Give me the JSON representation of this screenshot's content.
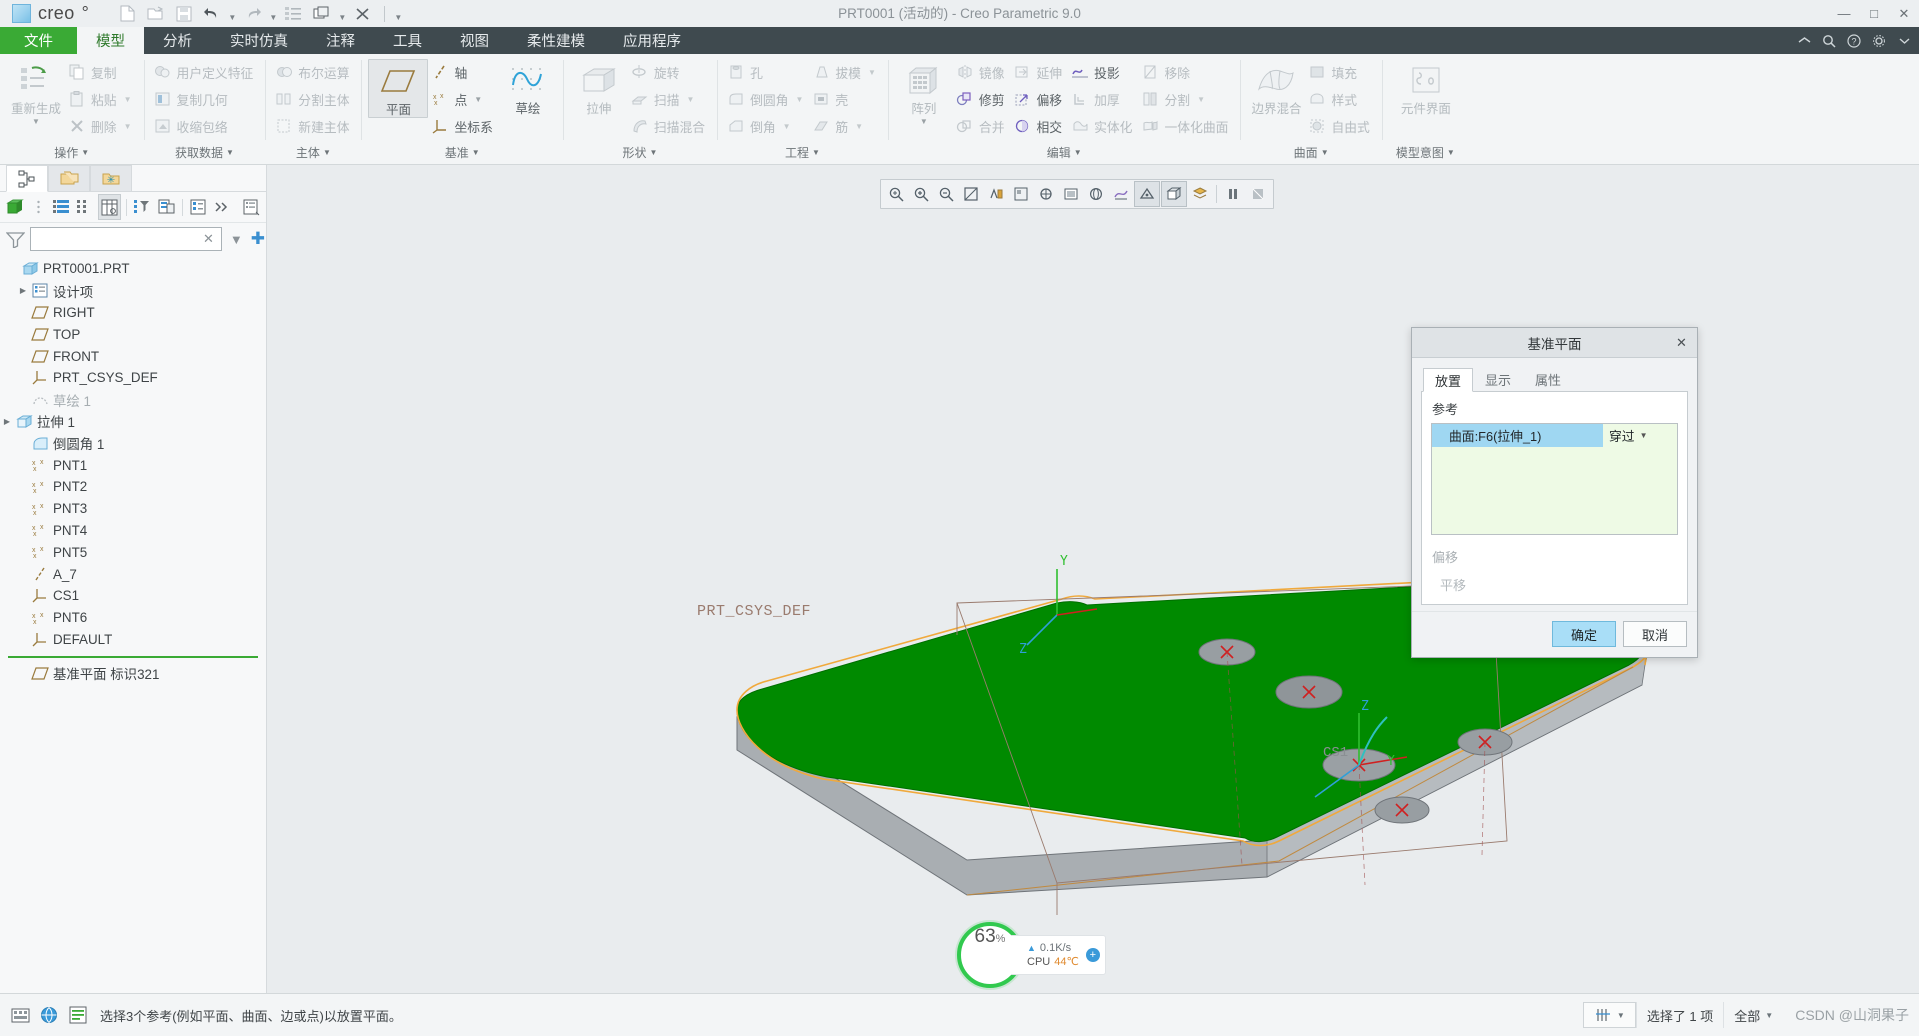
{
  "window": {
    "title": "PRT0001 (活动的) - Creo Parametric 9.0",
    "brand": "creo",
    "brand_dot": "°",
    "minimize": "—",
    "maximize": "□",
    "close": "✕"
  },
  "quick_access": {
    "items": [
      {
        "name": "new-file-icon",
        "glyph": "new"
      },
      {
        "name": "open-file-icon",
        "glyph": "open"
      },
      {
        "name": "save-icon",
        "glyph": "save"
      },
      {
        "name": "undo-icon",
        "glyph": "undo"
      },
      {
        "name": "redo-icon",
        "glyph": "redo"
      },
      {
        "name": "regenerate-icon",
        "glyph": "regen"
      },
      {
        "name": "window-switch-icon",
        "glyph": "window"
      },
      {
        "name": "close-window-icon",
        "glyph": "closewin"
      }
    ],
    "overflow_caret": "▼"
  },
  "tabs": {
    "items": [
      {
        "label": "文件",
        "state": "file"
      },
      {
        "label": "模型",
        "state": "active"
      },
      {
        "label": "分析",
        "state": "normal"
      },
      {
        "label": "实时仿真",
        "state": "normal"
      },
      {
        "label": "注释",
        "state": "normal"
      },
      {
        "label": "工具",
        "state": "normal"
      },
      {
        "label": "视图",
        "state": "normal"
      },
      {
        "label": "柔性建模",
        "state": "normal"
      },
      {
        "label": "应用程序",
        "state": "normal"
      }
    ],
    "right_icons": [
      {
        "name": "ribbon-collapse-icon",
        "glyph": "^"
      },
      {
        "name": "search-icon",
        "glyph": "search"
      },
      {
        "name": "help-icon",
        "glyph": "?"
      },
      {
        "name": "settings-icon",
        "glyph": "gear"
      },
      {
        "name": "minimize-ribbon-icon",
        "glyph": "-"
      }
    ]
  },
  "ribbon": {
    "groups": [
      {
        "label": "操作",
        "big": [
          {
            "label": "重新生成",
            "dim": true,
            "caret": "▼",
            "icon": "regenerate-big-icon"
          }
        ],
        "columns": [
          [
            {
              "label": "复制",
              "icon": "copy-icon",
              "dim": true,
              "caret": ""
            },
            {
              "label": "粘贴",
              "icon": "paste-icon",
              "dim": true,
              "caret": "▼"
            },
            {
              "label": "删除",
              "icon": "delete-icon",
              "dim": true,
              "caret": "▼"
            }
          ]
        ]
      },
      {
        "label": "获取数据",
        "big": [],
        "columns": [
          [
            {
              "label": "用户定义特征",
              "icon": "udf-icon",
              "dim": true,
              "caret": ""
            },
            {
              "label": "复制几何",
              "icon": "copy-geom-icon",
              "dim": true,
              "caret": ""
            },
            {
              "label": "收缩包络",
              "icon": "shrinkwrap-icon",
              "dim": true,
              "caret": ""
            }
          ]
        ]
      },
      {
        "label": "主体",
        "big": [],
        "columns": [
          [
            {
              "label": "布尔运算",
              "icon": "boolean-icon",
              "dim": true,
              "caret": ""
            },
            {
              "label": "分割主体",
              "icon": "split-body-icon",
              "dim": true,
              "caret": ""
            },
            {
              "label": "新建主体",
              "icon": "new-body-icon",
              "dim": true,
              "caret": ""
            }
          ]
        ]
      },
      {
        "label": "基准",
        "big": [
          {
            "label": "平面",
            "dim": false,
            "selected": true,
            "caret": "",
            "icon": "datum-plane-big-icon"
          },
          {
            "label": "草绘",
            "dim": false,
            "caret": "",
            "icon": "sketch-big-icon"
          }
        ],
        "columns": [
          [
            {
              "label": "轴",
              "icon": "datum-axis-icon",
              "dim": false,
              "caret": ""
            },
            {
              "label": "点",
              "icon": "datum-point-icon",
              "dim": false,
              "caret": "▼"
            },
            {
              "label": "坐标系",
              "icon": "datum-csys-icon",
              "dim": false,
              "caret": ""
            }
          ]
        ]
      },
      {
        "label": "形状",
        "big": [
          {
            "label": "拉伸",
            "dim": true,
            "caret": "",
            "icon": "extrude-big-icon"
          }
        ],
        "columns": [
          [
            {
              "label": "旋转",
              "icon": "revolve-icon",
              "dim": true,
              "caret": ""
            },
            {
              "label": "扫描",
              "icon": "sweep-icon",
              "dim": true,
              "caret": "▼"
            },
            {
              "label": "扫描混合",
              "icon": "swept-blend-icon",
              "dim": true,
              "caret": ""
            }
          ]
        ]
      },
      {
        "label": "工程",
        "big": [],
        "columns": [
          [
            {
              "label": "孔",
              "icon": "hole-icon",
              "dim": true,
              "caret": ""
            },
            {
              "label": "倒圆角",
              "icon": "round-icon",
              "dim": true,
              "caret": "▼"
            },
            {
              "label": "倒角",
              "icon": "chamfer-icon",
              "dim": true,
              "caret": "▼"
            }
          ],
          [
            {
              "label": "拔模",
              "icon": "draft-icon",
              "dim": true,
              "caret": "▼"
            },
            {
              "label": "壳",
              "icon": "shell-icon",
              "dim": true,
              "caret": ""
            },
            {
              "label": "筋",
              "icon": "rib-icon",
              "dim": true,
              "caret": "▼"
            }
          ]
        ]
      },
      {
        "label": "编辑",
        "big": [
          {
            "label": "阵列",
            "dim": true,
            "caret": "▼",
            "icon": "pattern-big-icon"
          }
        ],
        "columns": [
          [
            {
              "label": "镜像",
              "icon": "mirror-icon",
              "dim": true,
              "caret": ""
            },
            {
              "label": "修剪",
              "icon": "trim-icon",
              "dim": false,
              "caret": ""
            },
            {
              "label": "合并",
              "icon": "merge-icon",
              "dim": true,
              "caret": ""
            }
          ],
          [
            {
              "label": "延伸",
              "icon": "extend-icon",
              "dim": true,
              "caret": ""
            },
            {
              "label": "偏移",
              "icon": "offset-icon",
              "dim": false,
              "caret": ""
            },
            {
              "label": "相交",
              "icon": "intersect-icon",
              "dim": false,
              "caret": ""
            }
          ],
          [
            {
              "label": "投影",
              "icon": "project-icon",
              "dim": false,
              "caret": ""
            },
            {
              "label": "加厚",
              "icon": "thicken-icon",
              "dim": true,
              "caret": ""
            },
            {
              "label": "实体化",
              "icon": "solidify-icon",
              "dim": true,
              "caret": ""
            }
          ],
          [
            {
              "label": "移除",
              "icon": "remove-icon",
              "dim": true,
              "caret": ""
            },
            {
              "label": "分割",
              "icon": "split-surf-icon",
              "dim": true,
              "caret": "▼"
            },
            {
              "label": "一体化曲面",
              "icon": "unify-surf-icon",
              "dim": true,
              "caret": ""
            }
          ]
        ]
      },
      {
        "label": "曲面",
        "big": [
          {
            "label": "边界混合",
            "dim": true,
            "caret": "",
            "icon": "boundary-blend-big-icon"
          }
        ],
        "columns": [
          [
            {
              "label": "填充",
              "icon": "fill-icon",
              "dim": true,
              "caret": ""
            },
            {
              "label": "样式",
              "icon": "style-icon",
              "dim": true,
              "caret": ""
            },
            {
              "label": "自由式",
              "icon": "freestyle-icon",
              "dim": true,
              "caret": ""
            }
          ]
        ]
      },
      {
        "label": "模型意图",
        "big": [
          {
            "label": "元件界面",
            "dim": true,
            "caret": "",
            "icon": "component-interface-big-icon"
          }
        ],
        "columns": []
      }
    ]
  },
  "left_panel": {
    "nav_tabs": [
      {
        "name": "model-tree-tab",
        "state": "on"
      },
      {
        "name": "folder-browser-tab",
        "state": "grey"
      },
      {
        "name": "favorites-tab",
        "state": "grey"
      }
    ],
    "toolbar": [
      {
        "name": "show-model-icon",
        "state": "off"
      },
      {
        "name": "list-view-icon",
        "state": "off"
      },
      {
        "name": "tree-columns-icon",
        "state": "off"
      },
      {
        "name": "tree-grid-icon",
        "state": "on"
      },
      {
        "name": "tree-filter-icon",
        "state": "off"
      },
      {
        "name": "tree-layers-icon",
        "state": "off"
      },
      {
        "name": "tree-details-icon",
        "state": "off"
      },
      {
        "name": "more-icon",
        "state": "off"
      },
      {
        "name": "settings-tree-icon",
        "state": "off"
      }
    ],
    "filter": {
      "placeholder": "",
      "value": "",
      "clear_glyph": "✕",
      "dropdown_glyph": "▼",
      "add_glyph": "✚"
    },
    "tree": [
      {
        "label": "PRT0001.PRT",
        "icon": "part-icon",
        "indent": 0,
        "arrow": "",
        "dim": false
      },
      {
        "label": "设计项",
        "icon": "design-items-icon",
        "indent": 1,
        "arrow": "▶",
        "dim": false
      },
      {
        "label": "RIGHT",
        "icon": "datum-plane-icon",
        "indent": 1,
        "arrow": "",
        "dim": false
      },
      {
        "label": "TOP",
        "icon": "datum-plane-icon",
        "indent": 1,
        "arrow": "",
        "dim": false
      },
      {
        "label": "FRONT",
        "icon": "datum-plane-icon",
        "indent": 1,
        "arrow": "",
        "dim": false
      },
      {
        "label": "PRT_CSYS_DEF",
        "icon": "csys-icon",
        "indent": 1,
        "arrow": "",
        "dim": false
      },
      {
        "label": "草绘 1",
        "icon": "sketch-icon",
        "indent": 1,
        "arrow": "",
        "dim": true
      },
      {
        "label": "拉伸 1",
        "icon": "extrude-icon",
        "indent": 1,
        "arrow": "▶",
        "dim": false
      },
      {
        "label": "倒圆角 1",
        "icon": "round-tree-icon",
        "indent": 1,
        "arrow": "",
        "dim": false
      },
      {
        "label": "PNT1",
        "icon": "point-icon",
        "indent": 1,
        "arrow": "",
        "dim": false
      },
      {
        "label": "PNT2",
        "icon": "point-icon",
        "indent": 1,
        "arrow": "",
        "dim": false
      },
      {
        "label": "PNT3",
        "icon": "point-icon",
        "indent": 1,
        "arrow": "",
        "dim": false
      },
      {
        "label": "PNT4",
        "icon": "point-icon",
        "indent": 1,
        "arrow": "",
        "dim": false
      },
      {
        "label": "PNT5",
        "icon": "point-icon",
        "indent": 1,
        "arrow": "",
        "dim": false
      },
      {
        "label": "A_7",
        "icon": "axis-icon",
        "indent": 1,
        "arrow": "",
        "dim": false
      },
      {
        "label": "CS1",
        "icon": "csys-icon",
        "indent": 1,
        "arrow": "",
        "dim": false
      },
      {
        "label": "PNT6",
        "icon": "point-icon",
        "indent": 1,
        "arrow": "",
        "dim": false
      },
      {
        "label": "DEFAULT",
        "icon": "csys-icon",
        "indent": 1,
        "arrow": "",
        "dim": false
      }
    ],
    "tree_after_insert": [
      {
        "label": "基准平面 标识321",
        "icon": "datum-plane-icon",
        "indent": 1,
        "arrow": "",
        "dim": false
      }
    ]
  },
  "view_toolbar": {
    "items": [
      {
        "name": "refit-icon",
        "state": "off"
      },
      {
        "name": "zoom-in-icon",
        "state": "off"
      },
      {
        "name": "zoom-out-icon",
        "state": "off"
      },
      {
        "name": "repaint-icon",
        "state": "off"
      },
      {
        "name": "datum-display-icon",
        "state": "off"
      },
      {
        "name": "saved-orientations-icon",
        "state": "off"
      },
      {
        "name": "view-manager-icon",
        "state": "off"
      },
      {
        "name": "appearance-icon",
        "state": "off"
      },
      {
        "name": "perspective-icon",
        "state": "off"
      },
      {
        "name": "annotation-display-icon",
        "state": "off"
      },
      {
        "name": "spin-center-icon",
        "state": "on"
      },
      {
        "name": "display-style-icon",
        "state": "on"
      },
      {
        "name": "layer-icon",
        "state": "off"
      },
      {
        "name": "pause-icon",
        "state": "off"
      },
      {
        "name": "stop-icon",
        "state": "off"
      }
    ]
  },
  "viewport": {
    "labels": [
      {
        "text": "PRT_CSYS_DEF",
        "name": "csys-label"
      },
      {
        "text": "CS1",
        "name": "cs1-label"
      },
      {
        "text": "Y",
        "name": "axis-y-label"
      },
      {
        "text": "Z",
        "name": "axis-z-label"
      },
      {
        "text": "X",
        "name": "axis-x-label"
      }
    ],
    "colors": {
      "top_face": "#008a00",
      "side_face": "#a9aeb2",
      "highlight_edge": "#f0a93c",
      "arrow": "#b428c8",
      "background": "#e9ecee"
    }
  },
  "performance": {
    "percent": "63",
    "percent_unit": "%",
    "network": "0.1K/s",
    "network_arrow": "▲",
    "cpu_label": "CPU",
    "cpu_value": "44℃",
    "expand_glyph": "+"
  },
  "dialog": {
    "title": "基准平面",
    "close_glyph": "✕",
    "tabs": [
      {
        "label": "放置",
        "on": true
      },
      {
        "label": "显示",
        "on": false
      },
      {
        "label": "属性",
        "on": false
      }
    ],
    "section_label": "参考",
    "references": [
      {
        "name": "曲面:F6(拉伸_1)",
        "mode": "穿过",
        "caret": "▼"
      }
    ],
    "offset_label": "偏移",
    "translate_label": "平移",
    "ok_label": "确定",
    "cancel_label": "取消"
  },
  "status_bar": {
    "message": "选择3个参考(例如平面、曲面、边或点)以放置平面。",
    "selected_count": "选择了 1 项",
    "filter_label": "全部",
    "filter_caret": "▼",
    "watermark": "CSDN @山洞果子",
    "left_icons": [
      {
        "name": "keyboard-shortcut-icon"
      },
      {
        "name": "globe-icon"
      },
      {
        "name": "info-icon"
      }
    ],
    "right_icon": "selection-filter-icon"
  }
}
